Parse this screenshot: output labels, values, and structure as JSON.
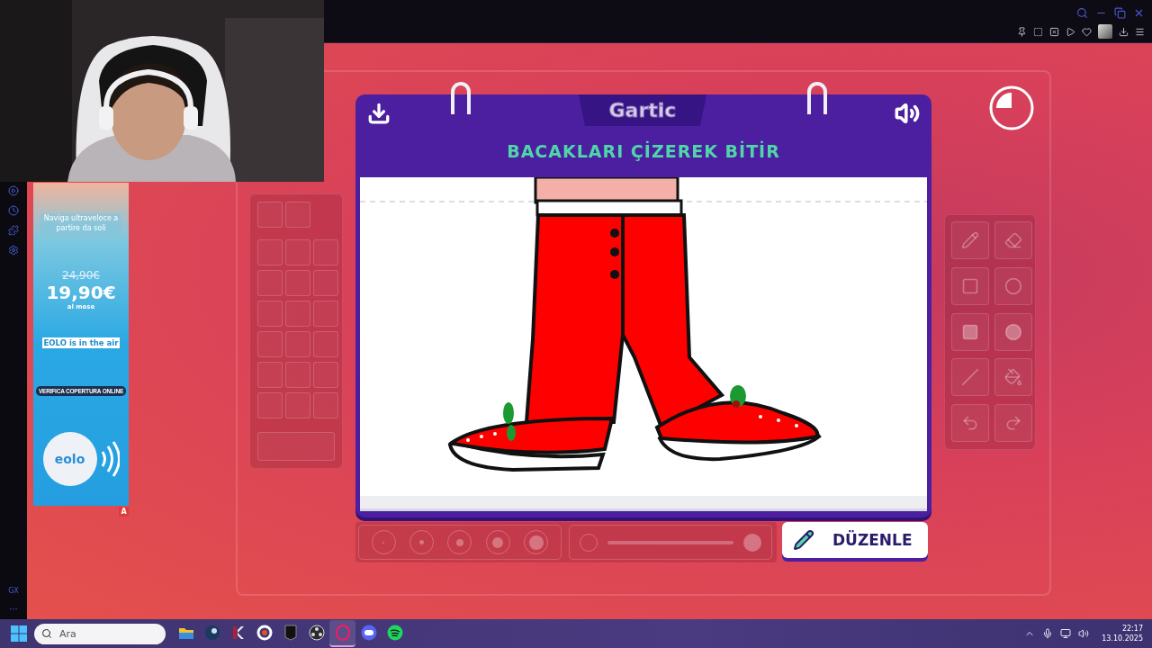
{
  "sidebar": {
    "footer_label": "GX",
    "more": "···"
  },
  "ad": {
    "headline": "Naviga ultraveloce a partire da soli",
    "old_price": "24,90€",
    "price": "19,90€",
    "period": "al mese",
    "slogan": "EOLO is in the air",
    "cta": "VERIFICA COPERTURA ONLINE",
    "logo": "eolo",
    "badge": "A"
  },
  "game": {
    "logo": "Gartic",
    "title": "BACAKLARI ÇİZEREK BİTİR",
    "timer": {
      "level": 0.25
    },
    "action_button": "DÜZENLE"
  },
  "taskbar": {
    "search": {
      "placeholder": "Ara"
    },
    "apps": [
      {
        "kind": "folder",
        "selected": false
      },
      {
        "kind": "steam",
        "selected": false
      },
      {
        "kind": "cross",
        "selected": false
      },
      {
        "kind": "ring",
        "selected": false
      },
      {
        "kind": "shield",
        "selected": false
      },
      {
        "kind": "obs",
        "selected": false
      },
      {
        "kind": "opera",
        "selected": true
      },
      {
        "kind": "chat",
        "selected": false
      },
      {
        "kind": "music",
        "selected": false
      }
    ],
    "time": "22:17",
    "date": "13.10.2025"
  }
}
